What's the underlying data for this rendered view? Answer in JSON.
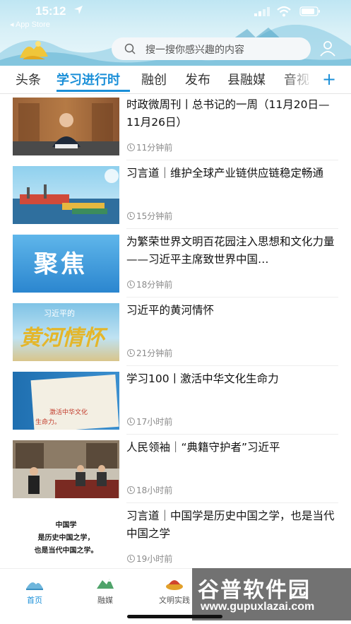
{
  "status": {
    "time": "15:12",
    "back_label": "◂ App Store"
  },
  "search": {
    "placeholder": "搜一搜你感兴趣的内容"
  },
  "tabs": [
    {
      "label": "头条"
    },
    {
      "label": "学习进行时",
      "active": true
    },
    {
      "label": "融创"
    },
    {
      "label": "发布"
    },
    {
      "label": "县融媒"
    },
    {
      "label": "音视"
    }
  ],
  "tab_add": "+",
  "news": [
    {
      "title": "时政微周刊丨总书记的一周（11月20日—11月26日）",
      "time": "11分钟前"
    },
    {
      "title": "习言道｜维护全球产业链供应链稳定畅通",
      "time": "15分钟前"
    },
    {
      "title": "为繁荣世界文明百花园注入思想和文化力量——习近平主席致世界中国…",
      "time": "18分钟前"
    },
    {
      "title": "习近平的黄河情怀",
      "time": "21分钟前"
    },
    {
      "title": "学习100丨激活中华文化生命力",
      "time": "17小时前"
    },
    {
      "title": "人民领袖｜“典籍守护者”习近平",
      "time": "18小时前"
    },
    {
      "title": "习言道｜中国学是历史中国之学，也是当代中国之学",
      "time": "19小时前"
    }
  ],
  "thumbs": {
    "t3_text": "聚焦",
    "t4_top": "习近平的",
    "t4_main": "黄河情怀",
    "t5_line1": "激活中华文化",
    "t5_line2": "生命力。",
    "t7_line1": "中国学",
    "t7_line2": "是历史中国之学，",
    "t7_line3": "也是当代中国之学。"
  },
  "bottom_nav": [
    {
      "label": "首页",
      "active": true
    },
    {
      "label": "融媒"
    },
    {
      "label": "文明实践"
    }
  ],
  "watermark": {
    "big": "谷普软件园",
    "small": "www.gupuxlazai.com"
  },
  "colors": {
    "accent": "#1a8fd8"
  }
}
